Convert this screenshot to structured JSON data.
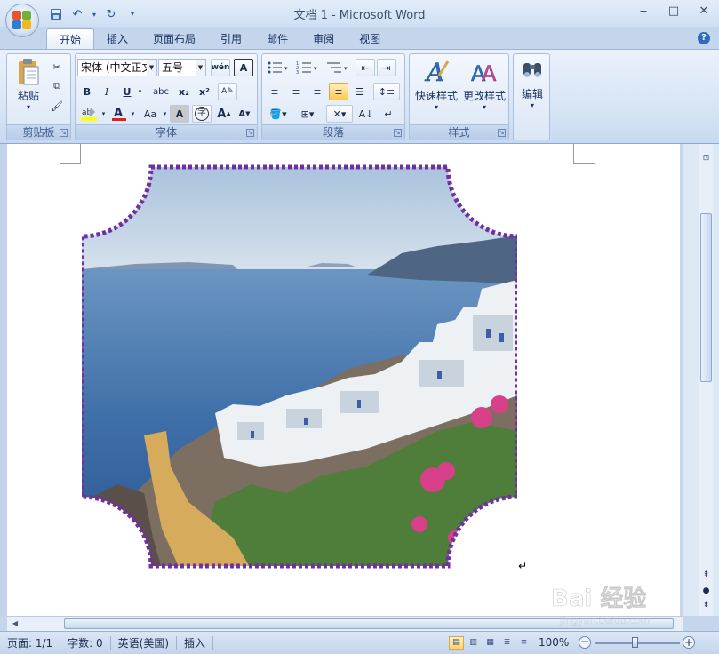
{
  "title_bar": {
    "title": "文档 1 - Microsoft Word",
    "qat": [
      "save-icon",
      "undo-icon",
      "redo-icon",
      "customize-icon"
    ],
    "controls": [
      "minimize-icon",
      "maximize-icon",
      "close-icon"
    ]
  },
  "tabs": [
    {
      "label": "开始",
      "active": true
    },
    {
      "label": "插入"
    },
    {
      "label": "页面布局"
    },
    {
      "label": "引用"
    },
    {
      "label": "邮件"
    },
    {
      "label": "审阅"
    },
    {
      "label": "视图"
    }
  ],
  "ribbon": {
    "clipboard": {
      "group_label": "剪贴板",
      "paste_label": "粘贴"
    },
    "font": {
      "group_label": "字体",
      "font_name": "宋体 (中文正文",
      "font_size": "五号",
      "bold": "B",
      "italic": "I",
      "underline": "U",
      "strike": "abc",
      "subscript": "x₂",
      "superscript": "x²",
      "change_case": "Aa",
      "grow": "A",
      "shrink": "A",
      "char_border": "A",
      "encircle": "字",
      "phonetic": "wén"
    },
    "paragraph": {
      "group_label": "段落"
    },
    "styles": {
      "group_label": "样式",
      "quick_styles": "快速样式",
      "change_styles": "更改样式"
    },
    "editing": {
      "label": "编辑"
    }
  },
  "document": {
    "picture_name": "santorini-picture"
  },
  "status_bar": {
    "page": "页面: 1/1",
    "words": "字数: 0",
    "language": "英语(美国)",
    "mode": "插入",
    "zoom": "100%"
  },
  "colors": {
    "picture_border": "#7030a0",
    "ribbon_bg": "#dbe7f6",
    "highlight_yellow": "#ffff00",
    "font_color_red": "#e02020"
  },
  "watermark": {
    "text": "Bai 经验",
    "url": "jingyan.baidu.com"
  }
}
